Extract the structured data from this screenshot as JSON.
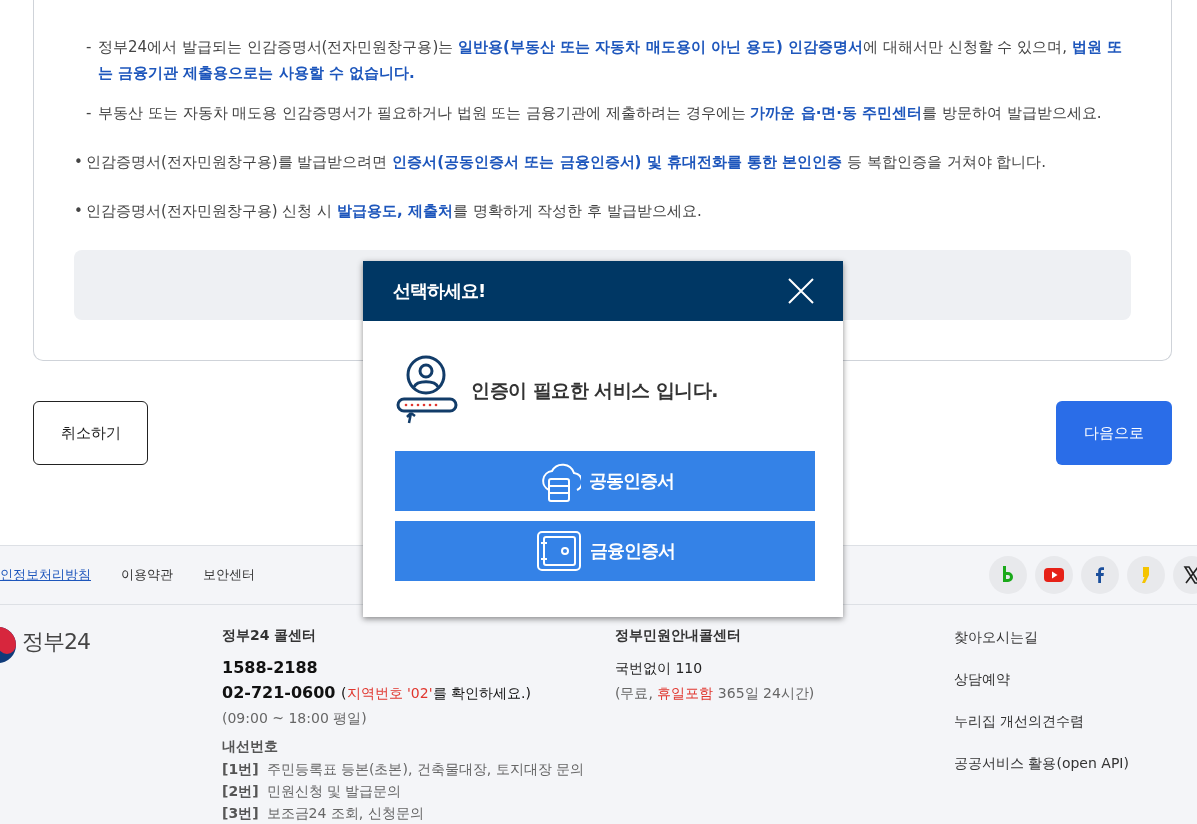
{
  "notice": {
    "items": [
      {
        "kind": "dash",
        "marker": "-",
        "text": "정부24에서 발급되는 인감증명서(전자민원창구용)는 **일반용(부동산 또는 자동차 매도용이 아닌 용도) 인감증명서**에 대해서만 신청할 수 있으며, **법원 또는 금융기관 제출용으로는 사용할 수 없습니다.**"
      },
      {
        "kind": "dash",
        "marker": "-",
        "text": "부동산 또는 자동차 매도용 인감증명서가 필요하거나 법원 또는 금융기관에 제출하려는 경우에는 **가까운 읍·면·동 주민센터**를 방문하여 발급받으세요."
      },
      {
        "kind": "bullet",
        "marker": "•",
        "text": "인감증명서(전자민원창구용)를 발급받으려면 **인증서(공동인증서 또는 금융인증서) 및 휴대전화를 통한 본인인증** 등 복합인증을 거쳐야 합니다."
      },
      {
        "kind": "bullet",
        "marker": "•",
        "text": "인감증명서(전자민원창구용) 신청 시 **발급용도, 제출처**를 명확하게 작성한 후 발급받으세요."
      }
    ]
  },
  "actions": {
    "cancel": "취소하기",
    "next": "다음으로"
  },
  "footer": {
    "links": [
      {
        "kind": "link",
        "text": "인정보처리방침"
      },
      {
        "kind": "plain",
        "text": "이용약관"
      },
      {
        "kind": "plain",
        "text": "보안센터"
      }
    ],
    "logo": "정부24",
    "call_center": {
      "title": "정부24 콜센터",
      "phone": "1588-2188",
      "phone_2": "02-721-0600",
      "note": [
        {
          "kind": "plain",
          "text": "("
        },
        {
          "kind": "highlight",
          "text": "지역번호 '02'"
        },
        {
          "kind": "plain",
          "text": "를 확인하세요.)"
        }
      ],
      "hours": "(09:00 ~ 18:00 평일)",
      "extension_title": "내선번호",
      "extensions": [
        {
          "num": "[1번]",
          "text": "주민등록표 등본(초본), 건축물대장, 토지대장 문의"
        },
        {
          "num": "[2번]",
          "text": "민원신청 및 발급문의"
        },
        {
          "num": "[3번]",
          "text": "보조금24 조회, 신청문의"
        }
      ]
    },
    "civil_center": {
      "title": "정부민원안내콜센터",
      "number": "국번없이 110",
      "note": [
        {
          "kind": "plain",
          "text": "(무료, "
        },
        {
          "kind": "highlight",
          "text": "휴일포함"
        },
        {
          "kind": "plain",
          "text": " 365일 24시간)"
        }
      ]
    },
    "side_links": [
      "찾아오시는길",
      "상담예약",
      "누리집 개선의견수렴",
      "공공서비스 활용(open API)"
    ]
  },
  "modal": {
    "title": "선택하세요!",
    "message": "인증이 필요한 서비스 입니다.",
    "options": [
      {
        "kind": "cloud",
        "label": "공동인증서"
      },
      {
        "kind": "safe",
        "label": "금융인증서"
      }
    ]
  }
}
